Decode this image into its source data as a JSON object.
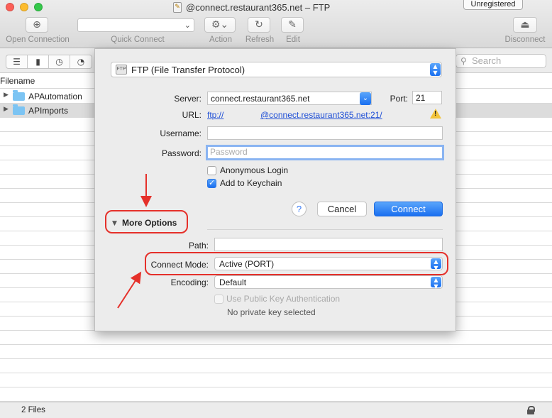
{
  "window": {
    "title": "@connect.restaurant365.net – FTP",
    "badge": "Unregistered"
  },
  "toolbar": {
    "open_connection": "Open Connection",
    "quick_connect": "Quick Connect",
    "action": "Action",
    "refresh": "Refresh",
    "edit": "Edit",
    "disconnect": "Disconnect"
  },
  "search": {
    "placeholder": "Search"
  },
  "file_list": {
    "header": "Filename",
    "rows": [
      {
        "name": "APAutomation",
        "selected": false
      },
      {
        "name": "APImports",
        "selected": true
      }
    ]
  },
  "status": {
    "count": "2 Files"
  },
  "dialog": {
    "protocol": "FTP (File Transfer Protocol)",
    "server_label": "Server:",
    "server_value": "connect.restaurant365.net",
    "port_label": "Port:",
    "port_value": "21",
    "url_label": "URL:",
    "url_scheme": "ftp://",
    "url_host": "@connect.restaurant365.net:21/",
    "username_label": "Username:",
    "username_value": "",
    "password_label": "Password:",
    "password_placeholder": "Password",
    "anonymous_login": "Anonymous Login",
    "anonymous_checked": false,
    "add_keychain": "Add to Keychain",
    "add_keychain_checked": true,
    "help": "?",
    "cancel": "Cancel",
    "connect": "Connect",
    "more_options": "More Options",
    "path_label": "Path:",
    "path_value": "",
    "connect_mode_label": "Connect Mode:",
    "connect_mode_value": "Active (PORT)",
    "encoding_label": "Encoding:",
    "encoding_value": "Default",
    "public_key_auth": "Use Public Key Authentication",
    "no_private_key": "No private key selected"
  },
  "colors": {
    "accent": "#1a6ff0",
    "annotation": "#e5302a",
    "link": "#1f4fd6"
  }
}
